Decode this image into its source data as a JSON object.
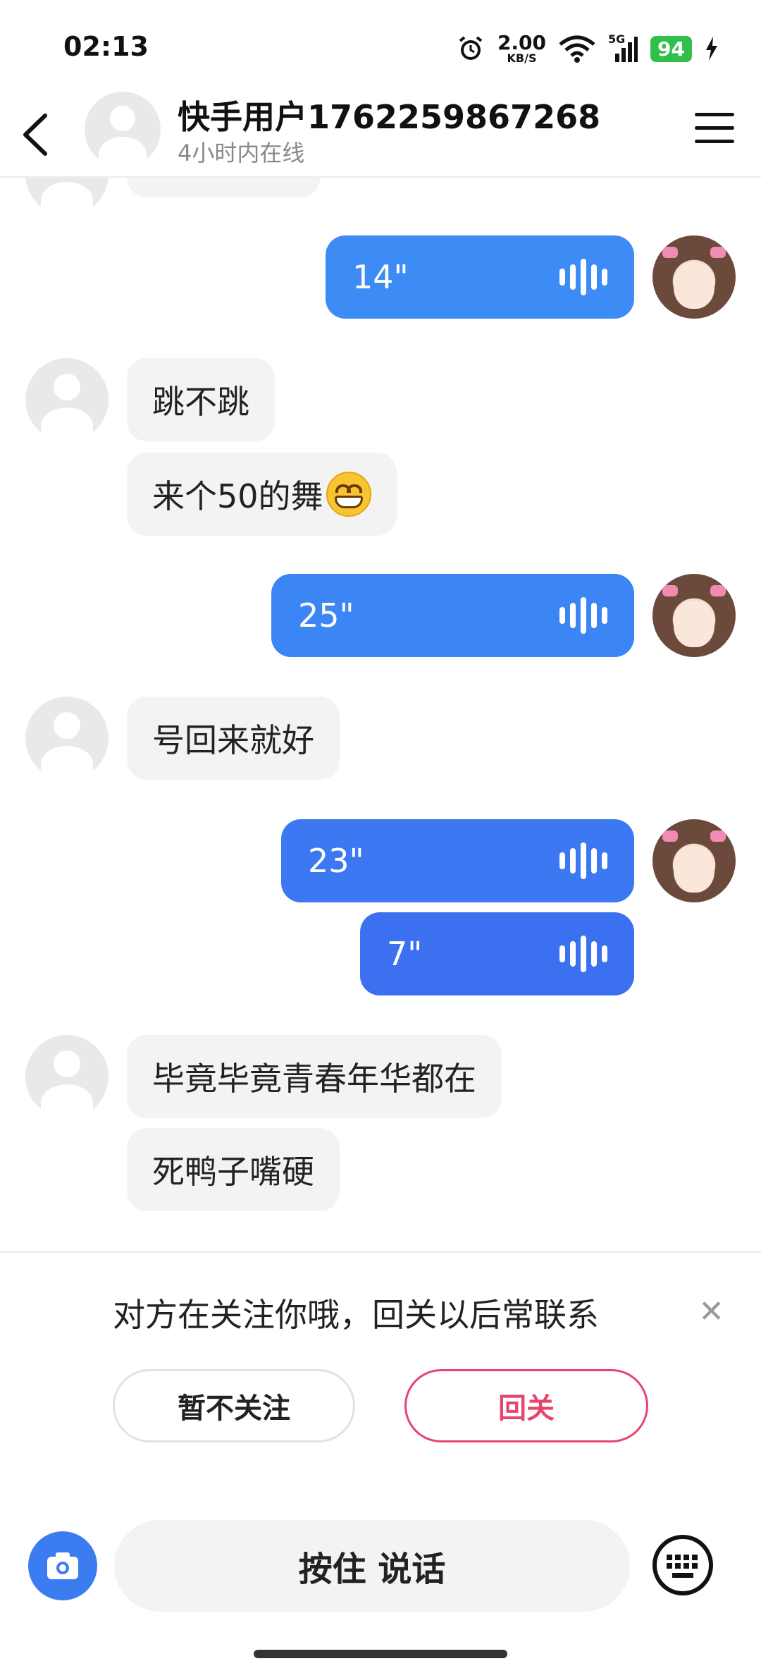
{
  "status_bar": {
    "time": "02:13",
    "net_speed_value": "2.00",
    "net_speed_unit": "KB/S",
    "network": "5G",
    "battery": "94"
  },
  "header": {
    "contact_name": "快手用户1762259867268",
    "online_status": "4小时内在线"
  },
  "messages": [
    {
      "side": "self",
      "type": "voice",
      "duration": "14\"",
      "color": "#3d8bf5"
    },
    {
      "side": "other",
      "type": "text",
      "text": "跳不跳"
    },
    {
      "side": "other",
      "type": "text",
      "text": "来个50的舞",
      "emoji": "grin-emoji"
    },
    {
      "side": "self",
      "type": "voice",
      "duration": "25\"",
      "color": "#3c85f4"
    },
    {
      "side": "other",
      "type": "text",
      "text": "号回来就好"
    },
    {
      "side": "self",
      "type": "voice",
      "duration": "23\"",
      "color": "#3b78f2"
    },
    {
      "side": "self",
      "type": "voice",
      "duration": "7\"",
      "color": "#3b70f0"
    },
    {
      "side": "other",
      "type": "text",
      "text": "毕竟毕竟青春年华都在"
    },
    {
      "side": "other",
      "type": "text",
      "text": "死鸭子嘴硬"
    }
  ],
  "follow_prompt": {
    "text": "对方在关注你哦，回关以后常联系",
    "decline_label": "暂不关注",
    "follow_label": "回关",
    "accent_color": "#e6466e"
  },
  "input": {
    "hold_to_talk_label": "按住 说话"
  },
  "colors": {
    "voice_bubble": "#3d8bf5",
    "incoming_bubble": "#f3f3f3",
    "camera_button": "#3b7df0"
  }
}
